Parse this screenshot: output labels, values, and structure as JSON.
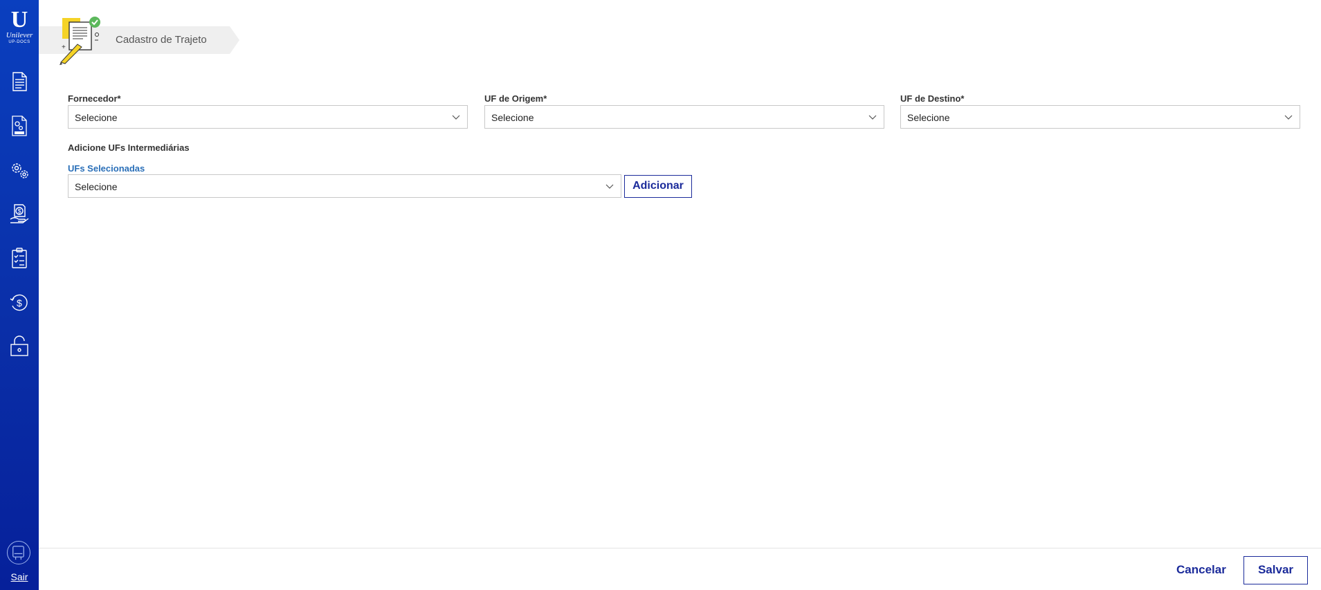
{
  "sidebar": {
    "logo": {
      "mark": "U",
      "brand": "Unilever",
      "sub": "UP-DOCS"
    },
    "items": [
      {
        "icon": "document-icon"
      },
      {
        "icon": "dfe-settings-icon"
      },
      {
        "icon": "gears-icon"
      },
      {
        "icon": "money-hand-icon"
      },
      {
        "icon": "checklist-icon"
      },
      {
        "icon": "refund-icon"
      },
      {
        "icon": "unlock-icon"
      }
    ],
    "exit_label": "Sair"
  },
  "header": {
    "title": "Cadastro de Trajeto"
  },
  "form": {
    "fornecedor": {
      "label": "Fornecedor*",
      "value": "Selecione"
    },
    "uf_origem": {
      "label": "UF de Origem*",
      "value": "Selecione"
    },
    "uf_destino": {
      "label": "UF de Destino*",
      "value": "Selecione"
    },
    "intermediarias": {
      "section_title": "Adicione UFs Intermediárias",
      "label": "UFs Selecionadas",
      "value": "Selecione",
      "add_label": "Adicionar"
    }
  },
  "footer": {
    "cancel_label": "Cancelar",
    "save_label": "Salvar"
  },
  "colors": {
    "sidebar": "#0a3fbf",
    "accent": "#1a2a9a",
    "link": "#2a6fb8"
  }
}
